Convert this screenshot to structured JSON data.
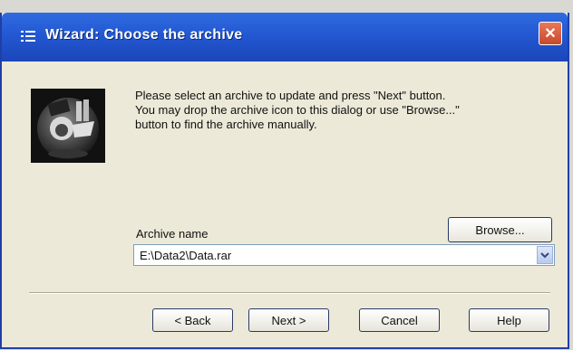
{
  "window": {
    "title": "Wizard:  Choose the archive",
    "icons": {
      "title_icon": "menu-lines-icon",
      "close": "close-icon",
      "wizard_image": "wizard-character-icon",
      "dropdown": "chevron-down-icon"
    }
  },
  "instructions": {
    "line1": "Please select an archive to update and press \"Next\" button.",
    "line2": "You may drop the archive icon to this dialog or use \"Browse...\"",
    "line3": "button to find the archive manually."
  },
  "archive": {
    "label": "Archive name",
    "value": "E:\\Data2\\Data.rar",
    "browse_label": "Browse..."
  },
  "buttons": {
    "back": "< Back",
    "next": "Next >",
    "cancel": "Cancel",
    "help": "Help"
  },
  "colors": {
    "titlebar": "#2358d2",
    "dialog_bg": "#ece9d8",
    "close_button": "#c64a2b"
  }
}
